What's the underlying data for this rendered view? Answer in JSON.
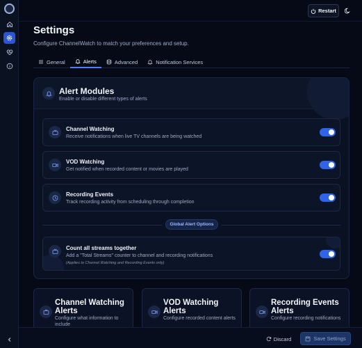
{
  "topbar": {
    "restart_label": "Restart"
  },
  "page": {
    "title": "Settings",
    "subtitle": "Configure ChannelWatch to match your preferences and setup."
  },
  "tabs": [
    {
      "label": "General"
    },
    {
      "label": "Alerts"
    },
    {
      "label": "Advanced"
    },
    {
      "label": "Notification Services"
    }
  ],
  "alert_modules": {
    "title": "Alert Modules",
    "subtitle": "Enable or disable different types of alerts",
    "items": [
      {
        "title": "Channel Watching",
        "description": "Receive notifications when live TV channels are being watched",
        "enabled": true
      },
      {
        "title": "VOD Watching",
        "description": "Get notified when recorded content or movies are played",
        "enabled": true
      },
      {
        "title": "Recording Events",
        "description": "Track recording activity from scheduling through completion",
        "enabled": true
      }
    ],
    "global_label": "Global Alert Options",
    "global_option": {
      "title": "Count all streams together",
      "description": "Add a \"Total Streams\" counter to channel and recording notifications",
      "note": "(Applies to Channel Watching and Recording Events only)",
      "enabled": true
    }
  },
  "sections": [
    {
      "title": "Channel Watching Alerts",
      "description": "Configure what information to include"
    },
    {
      "title": "VOD Watching Alerts",
      "description": "Configure recorded content alerts"
    },
    {
      "title": "Recording Events Alerts",
      "description": "Configure recording notifications"
    }
  ],
  "footer": {
    "discard_label": "Discard",
    "save_label": "Save Settings"
  },
  "colors": {
    "accent": "#2f63e8",
    "background": "#050a16",
    "card": "#0c1427"
  },
  "icons": {
    "rail": [
      "app-logo",
      "home-icon",
      "settings-icon",
      "heart-pulse-icon",
      "info-icon",
      "chevron-left-icon"
    ],
    "cards": [
      "tv-icon",
      "video-icon",
      "clock-icon",
      "tv-icon"
    ]
  }
}
